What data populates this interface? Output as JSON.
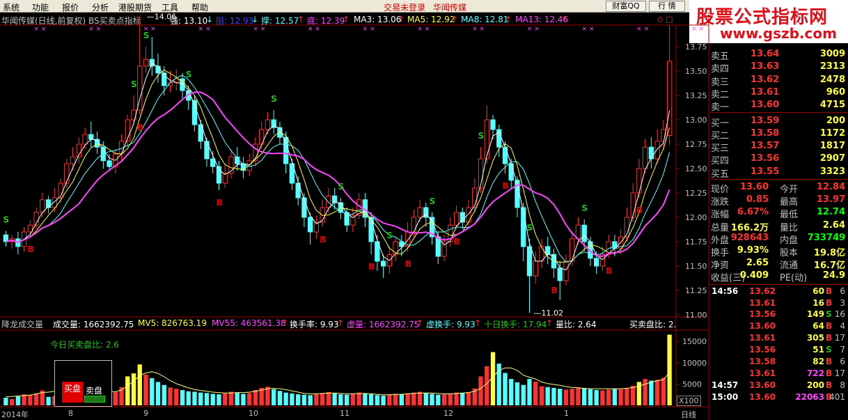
{
  "menu": [
    "系统",
    "功能",
    "报价",
    "分析",
    "港股期货",
    "工具",
    "帮助"
  ],
  "status_text": "交易未登录",
  "stock_title": "华闻传媒",
  "toolbar": {
    "wealth_label": "财富QQ",
    "quote_label": "行 情",
    "restore_label": "▫",
    "close_label": "×"
  },
  "logo": {
    "line1": "股票公式指标网",
    "line2": "www.gszb.com"
  },
  "chart_header": {
    "name": "华闻传媒(日线,前复权) BS买卖点指标",
    "strong": "强: 13.10",
    "res": "阻: 12.93",
    "sup": "撑: 12.57",
    "bot": "底: 12.39",
    "ma3": "MA3: 13.06",
    "ma5": "MA5: 12.92",
    "ma8": "MA8: 12.81",
    "ma13": "MA13: 12.46"
  },
  "sub_header": {
    "name": "降龙成交量",
    "vol": "成交量: 1662392.75",
    "mv5": "MV5: 826763.19",
    "mv55": "MV55: 463561.38",
    "turnover": "换手率: 9.93",
    "vvol": "虚量: 1662392.75",
    "vturn": "虚换手: 9.93",
    "turn10": "十日换手: 17.94",
    "ratio": "量比: 2.64",
    "bsratio": "买卖盘比: 2."
  },
  "sub_legend": {
    "ratio_text": "今日买卖盘比: 2.6",
    "buy": "买盘",
    "sell": "卖盘",
    "x100": "X100",
    "day_label": "日线"
  },
  "colors": {
    "up": "#ff3232",
    "down": "#54ffff",
    "ma_purple": "#ff44ff",
    "signal_s": "#20c020",
    "signal_b": "#e00000",
    "yellow": "#ffff40",
    "green_val": "#00ff00"
  },
  "price_axis": [
    "13.75",
    "13.50",
    "13.25",
    "13.00",
    "12.75",
    "12.50",
    "12.25",
    "12.00",
    "11.75",
    "11.50",
    "11.25",
    "11.00"
  ],
  "vol_axis": [
    "15000",
    "10000",
    "5000"
  ],
  "date_axis": [
    "2014年",
    "8",
    "9",
    "10",
    "11",
    "12",
    "1"
  ],
  "annotations": {
    "high": "14.06",
    "low": "11.02"
  },
  "orderbook": {
    "sells": [
      {
        "label": "卖五",
        "price": "13.64",
        "vol": "3009"
      },
      {
        "label": "卖四",
        "price": "13.63",
        "vol": "2313"
      },
      {
        "label": "卖三",
        "price": "13.62",
        "vol": "2478"
      },
      {
        "label": "卖二",
        "price": "13.61",
        "vol": "960"
      },
      {
        "label": "卖一",
        "price": "13.60",
        "vol": "4715"
      }
    ],
    "buys": [
      {
        "label": "买一",
        "price": "13.59",
        "vol": "200"
      },
      {
        "label": "买二",
        "price": "13.58",
        "vol": "1172"
      },
      {
        "label": "买三",
        "price": "13.57",
        "vol": "1817"
      },
      {
        "label": "买四",
        "price": "13.56",
        "vol": "2907"
      },
      {
        "label": "买五",
        "price": "13.55",
        "vol": "3323"
      }
    ]
  },
  "stats": [
    {
      "l1": "现价",
      "v1": "13.60",
      "l2": "今开",
      "v2": "12.84"
    },
    {
      "l1": "涨跌",
      "v1": "0.85",
      "l2": "最高",
      "v2": "13.97"
    },
    {
      "l1": "涨幅",
      "v1": "6.67%",
      "l2": "最低",
      "v2": "12.74"
    },
    {
      "l1": "总量",
      "v1": "166.2万",
      "l2": "量比",
      "v2": "2.64"
    },
    {
      "l1": "外盘",
      "v1": "928643",
      "l2": "内盘",
      "v2": "733749"
    },
    {
      "l1": "换手",
      "v1": "9.93%",
      "l2": "股本",
      "v2": "19.8亿"
    },
    {
      "l1": "净资",
      "v1": "2.65",
      "l2": "流通",
      "v2": "16.7亿"
    },
    {
      "l1": "收益(三)",
      "v1": "0.409",
      "l2": "PE(动)",
      "v2": "24.9"
    }
  ],
  "ticks": [
    {
      "time": "14:56",
      "price": "13.62",
      "vol": "60",
      "side": "B",
      "n": "6"
    },
    {
      "time": "",
      "price": "13.61",
      "vol": "16",
      "side": "B",
      "n": "3"
    },
    {
      "time": "",
      "price": "13.56",
      "vol": "149",
      "side": "S",
      "n": "16"
    },
    {
      "time": "",
      "price": "13.60",
      "vol": "64",
      "side": "B",
      "n": "4"
    },
    {
      "time": "",
      "price": "13.61",
      "vol": "305",
      "side": "B",
      "n": "17"
    },
    {
      "time": "",
      "price": "13.56",
      "vol": "51",
      "side": "S",
      "n": "7"
    },
    {
      "time": "",
      "price": "13.58",
      "vol": "82",
      "side": "B",
      "n": "6"
    },
    {
      "time": "",
      "price": "13.61",
      "vol": "722",
      "side": "B",
      "n": "17"
    },
    {
      "time": "14:57",
      "price": "13.60",
      "vol": "200",
      "side": "B",
      "n": "8"
    },
    {
      "time": "15:00",
      "price": "13.60",
      "vol": "22063",
      "side": "B",
      "n": "401"
    }
  ],
  "chart_data": {
    "type": "candlestick",
    "title": "华闻传媒(日线,前复权) BS买卖点指标",
    "ylim": [
      11.0,
      13.9
    ],
    "grid": false,
    "dates": [
      "2014年",
      "8",
      "9",
      "10",
      "11",
      "12",
      "1"
    ],
    "candles": [
      [
        11.82,
        11.75,
        11.86,
        11.7
      ],
      [
        11.75,
        11.78,
        11.82,
        11.68
      ],
      [
        11.78,
        11.7,
        11.85,
        11.62
      ],
      [
        11.7,
        11.85,
        11.9,
        11.65
      ],
      [
        11.85,
        11.92,
        11.97,
        11.8
      ],
      [
        11.92,
        12.05,
        12.1,
        11.88
      ],
      [
        12.05,
        12.18,
        12.25,
        12.0
      ],
      [
        12.18,
        12.1,
        12.22,
        12.04
      ],
      [
        12.1,
        12.2,
        12.3,
        12.05
      ],
      [
        12.2,
        12.35,
        12.4,
        12.15
      ],
      [
        12.35,
        12.55,
        12.6,
        12.3
      ],
      [
        12.55,
        12.62,
        12.72,
        12.48
      ],
      [
        12.62,
        12.75,
        12.82,
        12.55
      ],
      [
        12.75,
        12.85,
        12.92,
        12.7
      ],
      [
        12.85,
        12.8,
        12.98,
        12.72
      ],
      [
        12.8,
        12.72,
        12.88,
        12.65
      ],
      [
        12.72,
        12.58,
        12.78,
        12.5
      ],
      [
        12.58,
        12.52,
        12.65,
        12.48
      ],
      [
        12.52,
        12.65,
        12.7,
        12.45
      ],
      [
        12.65,
        12.78,
        12.85,
        12.58
      ],
      [
        12.78,
        13.0,
        13.05,
        12.72
      ],
      [
        13.0,
        13.1,
        13.25,
        12.95
      ],
      [
        13.1,
        13.55,
        14.06,
        13.05
      ],
      [
        13.55,
        13.62,
        13.75,
        13.48
      ],
      [
        13.62,
        13.55,
        13.85,
        13.45
      ],
      [
        13.55,
        13.48,
        13.68,
        13.38
      ],
      [
        13.48,
        13.35,
        13.55,
        13.25
      ],
      [
        13.35,
        13.38,
        13.5,
        13.28
      ],
      [
        13.38,
        13.42,
        13.52,
        13.3
      ],
      [
        13.42,
        13.3,
        13.48,
        13.22
      ],
      [
        13.3,
        13.2,
        13.35,
        13.1
      ],
      [
        13.2,
        12.95,
        13.25,
        12.88
      ],
      [
        12.95,
        12.78,
        13.0,
        12.7
      ],
      [
        12.78,
        12.6,
        12.82,
        12.52
      ],
      [
        12.6,
        12.52,
        12.68,
        12.45
      ],
      [
        12.52,
        12.35,
        12.58,
        12.28
      ],
      [
        12.35,
        12.45,
        12.55,
        12.3
      ],
      [
        12.45,
        12.62,
        12.7,
        12.4
      ],
      [
        12.62,
        12.55,
        12.72,
        12.48
      ],
      [
        12.55,
        12.48,
        12.62,
        12.4
      ],
      [
        12.48,
        12.58,
        12.65,
        12.42
      ],
      [
        12.58,
        12.75,
        12.82,
        12.52
      ],
      [
        12.75,
        12.9,
        12.98,
        12.7
      ],
      [
        12.9,
        13.0,
        13.08,
        12.85
      ],
      [
        13.0,
        12.92,
        13.1,
        12.85
      ],
      [
        12.92,
        12.82,
        12.98,
        12.75
      ],
      [
        12.82,
        12.55,
        12.88,
        12.45
      ],
      [
        12.55,
        12.35,
        12.6,
        12.28
      ],
      [
        12.35,
        12.2,
        12.42,
        12.12
      ],
      [
        12.2,
        12.0,
        12.25,
        11.9
      ],
      [
        12.0,
        11.85,
        12.05,
        11.72
      ],
      [
        11.85,
        11.95,
        12.02,
        11.78
      ],
      [
        11.95,
        12.1,
        12.18,
        11.9
      ],
      [
        12.1,
        12.22,
        12.3,
        12.05
      ],
      [
        12.22,
        12.15,
        12.3,
        12.08
      ],
      [
        12.15,
        12.05,
        12.2,
        11.98
      ],
      [
        12.05,
        11.92,
        12.1,
        11.85
      ],
      [
        11.92,
        12.02,
        12.1,
        11.85
      ],
      [
        12.02,
        12.18,
        12.25,
        11.98
      ],
      [
        12.18,
        12.0,
        12.25,
        11.9
      ],
      [
        12.0,
        11.75,
        12.05,
        11.62
      ],
      [
        11.75,
        11.55,
        11.82,
        11.45
      ],
      [
        11.55,
        11.5,
        11.62,
        11.38
      ],
      [
        11.5,
        11.62,
        11.7,
        11.42
      ],
      [
        11.62,
        11.75,
        11.8,
        11.55
      ],
      [
        11.75,
        11.7,
        11.82,
        11.6
      ],
      [
        11.7,
        11.85,
        11.95,
        11.65
      ],
      [
        11.85,
        12.0,
        12.08,
        11.8
      ],
      [
        12.0,
        12.1,
        12.18,
        11.95
      ],
      [
        12.1,
        12.0,
        12.15,
        11.9
      ],
      [
        12.0,
        11.8,
        12.05,
        11.72
      ],
      [
        11.8,
        11.6,
        11.85,
        11.52
      ],
      [
        11.6,
        11.75,
        11.82,
        11.55
      ],
      [
        11.75,
        11.92,
        12.0,
        11.7
      ],
      [
        11.92,
        12.05,
        12.12,
        11.88
      ],
      [
        12.05,
        11.95,
        12.1,
        11.88
      ],
      [
        11.95,
        12.1,
        12.18,
        11.9
      ],
      [
        12.1,
        12.3,
        12.4,
        12.05
      ],
      [
        12.3,
        12.6,
        12.72,
        12.25
      ],
      [
        12.6,
        13.0,
        13.15,
        12.55
      ],
      [
        13.0,
        12.9,
        13.05,
        12.8
      ],
      [
        12.9,
        12.72,
        12.95,
        12.62
      ],
      [
        12.72,
        12.55,
        12.78,
        12.45
      ],
      [
        12.55,
        12.38,
        12.6,
        12.3
      ],
      [
        12.38,
        12.1,
        12.42,
        12.0
      ],
      [
        12.1,
        11.7,
        12.15,
        11.55
      ],
      [
        11.7,
        11.4,
        11.78,
        11.02
      ],
      [
        11.4,
        11.55,
        11.65,
        11.32
      ],
      [
        11.55,
        11.7,
        11.78,
        11.48
      ],
      [
        11.7,
        11.62,
        11.8,
        11.52
      ],
      [
        11.62,
        11.48,
        11.68,
        11.38
      ],
      [
        11.48,
        11.35,
        11.55,
        11.15
      ],
      [
        11.35,
        11.55,
        11.62,
        11.3
      ],
      [
        11.55,
        11.78,
        11.85,
        11.5
      ],
      [
        11.78,
        11.92,
        12.0,
        11.72
      ],
      [
        11.92,
        11.75,
        11.98,
        11.65
      ],
      [
        11.75,
        11.58,
        11.8,
        11.5
      ],
      [
        11.58,
        11.5,
        11.65,
        11.42
      ],
      [
        11.5,
        11.62,
        11.7,
        11.45
      ],
      [
        11.62,
        11.75,
        11.82,
        11.58
      ],
      [
        11.75,
        11.68,
        11.82,
        11.6
      ],
      [
        11.68,
        11.8,
        11.88,
        11.62
      ],
      [
        11.8,
        12.0,
        12.1,
        11.75
      ],
      [
        12.0,
        12.25,
        12.35,
        11.95
      ],
      [
        12.25,
        12.5,
        12.6,
        12.2
      ],
      [
        12.5,
        12.72,
        12.8,
        12.45
      ],
      [
        12.72,
        12.6,
        12.82,
        12.5
      ],
      [
        12.6,
        12.78,
        12.9,
        12.55
      ],
      [
        12.78,
        12.9,
        13.0,
        12.7
      ],
      [
        12.84,
        13.6,
        13.97,
        12.74
      ]
    ],
    "signals": [
      {
        "i": 0,
        "type": "S"
      },
      {
        "i": 4,
        "type": "B"
      },
      {
        "i": 21,
        "type": "S"
      },
      {
        "i": 22,
        "type": "B"
      },
      {
        "i": 23,
        "type": "S"
      },
      {
        "i": 30,
        "type": "S"
      },
      {
        "i": 35,
        "type": "B"
      },
      {
        "i": 44,
        "type": "S"
      },
      {
        "i": 52,
        "type": "B"
      },
      {
        "i": 55,
        "type": "S"
      },
      {
        "i": 60,
        "type": "B"
      },
      {
        "i": 63,
        "type": "S"
      },
      {
        "i": 66,
        "type": "B"
      },
      {
        "i": 70,
        "type": "S"
      },
      {
        "i": 74,
        "type": "B"
      },
      {
        "i": 78,
        "type": "S"
      },
      {
        "i": 82,
        "type": "B"
      },
      {
        "i": 86,
        "type": "S"
      },
      {
        "i": 90,
        "type": "B"
      },
      {
        "i": 95,
        "type": "S"
      },
      {
        "i": 99,
        "type": "B"
      },
      {
        "i": 104,
        "type": "B"
      }
    ],
    "volume_ylim": [
      0,
      17000
    ],
    "volume": [
      1800,
      1500,
      2100,
      2600,
      2400,
      2800,
      3500,
      2000,
      2200,
      3000,
      4200,
      3800,
      4500,
      5000,
      3600,
      2800,
      2500,
      2200,
      3100,
      4300,
      6800,
      7500,
      9600,
      7200,
      6400,
      5500,
      4800,
      4200,
      3900,
      3600,
      3300,
      3200,
      3000,
      2900,
      2700,
      2600,
      2800,
      3200,
      3000,
      2700,
      2900,
      3600,
      4100,
      4400,
      3800,
      3400,
      3000,
      2800,
      2600,
      2500,
      2400,
      2600,
      2900,
      3100,
      2800,
      2600,
      2500,
      2700,
      3000,
      2800,
      2600,
      2400,
      2300,
      2500,
      2700,
      2600,
      2800,
      3000,
      3200,
      2900,
      2700,
      2500,
      2600,
      2800,
      3000,
      2900,
      3100,
      4000,
      6800,
      9200,
      12500,
      9800,
      7600,
      6200,
      5400,
      4800,
      6200,
      5600,
      4500,
      4300,
      4100,
      3900,
      3700,
      3900,
      4200,
      4000,
      3800,
      3600,
      3500,
      3700,
      3900,
      3800,
      4100,
      4600,
      5500,
      6200,
      5800,
      6000,
      6500,
      16600
    ],
    "ma_vol": [
      2000,
      2100,
      2200,
      2300,
      2400,
      2700,
      3000,
      3100,
      3300,
      3600,
      4000,
      4300,
      4600,
      4800,
      4600,
      4200,
      3700,
      3300,
      3200,
      3600,
      4600,
      5700,
      7000,
      7600,
      7900,
      7500,
      6700,
      5800,
      5100,
      4600,
      4100,
      3700,
      3500,
      3300,
      3100,
      3000,
      2900,
      2900,
      3000,
      3000,
      3100,
      3300,
      3600,
      3900,
      4000,
      3900,
      3700,
      3400,
      3100,
      2800,
      2700,
      2700,
      2800,
      2900,
      2900,
      2800,
      2700,
      2700,
      2800,
      2800,
      2700,
      2600,
      2500,
      2500,
      2600,
      2600,
      2700,
      2800,
      2900,
      2900,
      2900,
      2800,
      2700,
      2700,
      2800,
      2900,
      3000,
      3300,
      4000,
      5100,
      6700,
      8200,
      8800,
      8800,
      8200,
      7100,
      6600,
      6200,
      5500,
      5100,
      4900,
      4700,
      4400,
      4200,
      4100,
      4000,
      3900,
      3900,
      3900,
      3900,
      3900,
      3900,
      4000,
      4200,
      4500,
      5000,
      5400,
      5800,
      6000,
      7800
    ],
    "yellow_bars": [
      20,
      21,
      22,
      80,
      104,
      109
    ]
  }
}
